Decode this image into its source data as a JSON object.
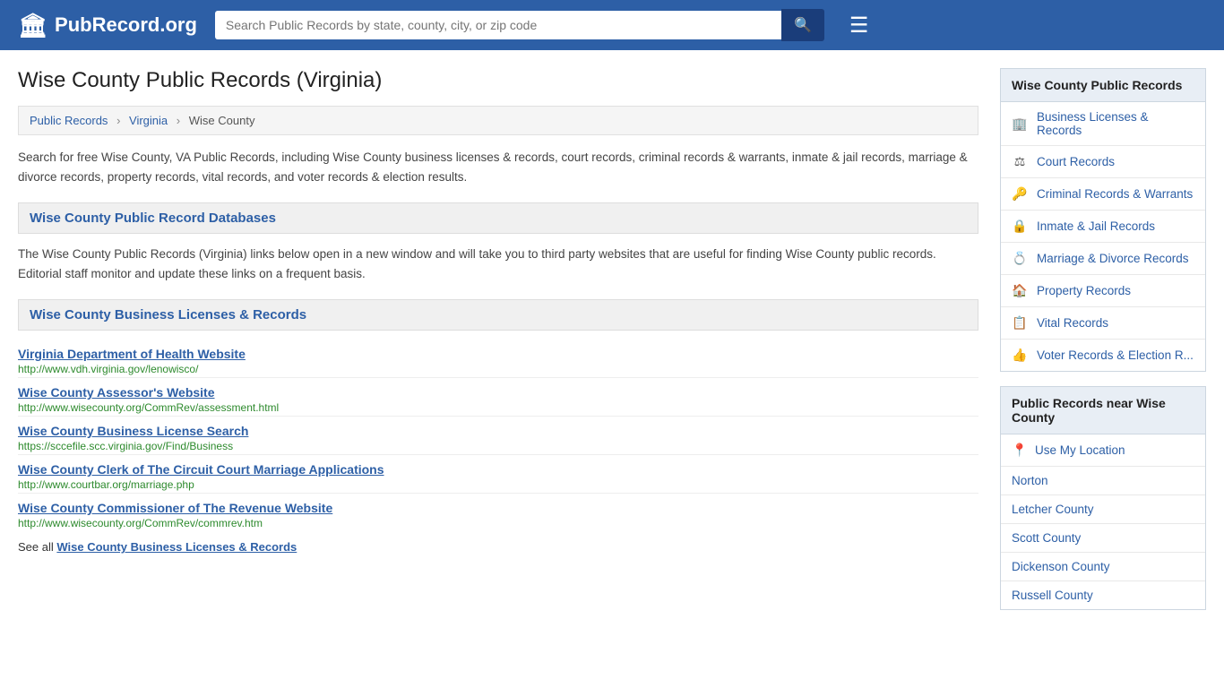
{
  "header": {
    "logo_icon": "🏛",
    "logo_text": "PubRecord.org",
    "search_placeholder": "Search Public Records by state, county, city, or zip code",
    "search_icon": "🔍",
    "menu_icon": "☰"
  },
  "page": {
    "title": "Wise County Public Records (Virginia)",
    "breadcrumb": {
      "items": [
        "Public Records",
        "Virginia",
        "Wise County"
      ]
    },
    "intro_text": "Search for free Wise County, VA Public Records, including Wise County business licenses & records, court records, criminal records & warrants, inmate & jail records, marriage & divorce records, property records, vital records, and voter records & election results.",
    "db_section_title": "Wise County Public Record Databases",
    "db_description": "The Wise County Public Records (Virginia) links below open in a new window and will take you to third party websites that are useful for finding Wise County public records. Editorial staff monitor and update these links on a frequent basis.",
    "business_section_title": "Wise County Business Licenses & Records",
    "records": [
      {
        "title": "Virginia Department of Health Website",
        "url": "http://www.vdh.virginia.gov/lenowisco/"
      },
      {
        "title": "Wise County Assessor's Website",
        "url": "http://www.wisecounty.org/CommRev/assessment.html"
      },
      {
        "title": "Wise County Business License Search",
        "url": "https://sccefile.scc.virginia.gov/Find/Business"
      },
      {
        "title": "Wise County Clerk of The Circuit Court Marriage Applications",
        "url": "http://www.courtbar.org/marriage.php"
      },
      {
        "title": "Wise County Commissioner of The Revenue Website",
        "url": "http://www.wisecounty.org/CommRev/commrev.htm"
      }
    ],
    "see_all_label": "See all",
    "see_all_link_text": "Wise County Business Licenses & Records"
  },
  "sidebar": {
    "public_records_header": "Wise County Public\nRecords",
    "public_records_items": [
      {
        "icon": "🏢",
        "label": "Business Licenses & Records"
      },
      {
        "icon": "⚖",
        "label": "Court Records"
      },
      {
        "icon": "🔑",
        "label": "Criminal Records & Warrants"
      },
      {
        "icon": "🔒",
        "label": "Inmate & Jail Records"
      },
      {
        "icon": "💍",
        "label": "Marriage & Divorce Records"
      },
      {
        "icon": "🏠",
        "label": "Property Records"
      },
      {
        "icon": "📋",
        "label": "Vital Records"
      },
      {
        "icon": "👍",
        "label": "Voter Records & Election R..."
      }
    ],
    "nearby_header": "Public Records near Wise\nCounty",
    "use_my_location": "Use My Location",
    "location_icon": "📍",
    "nearby_places": [
      "Norton",
      "Letcher County",
      "Scott County",
      "Dickenson County",
      "Russell County"
    ]
  }
}
